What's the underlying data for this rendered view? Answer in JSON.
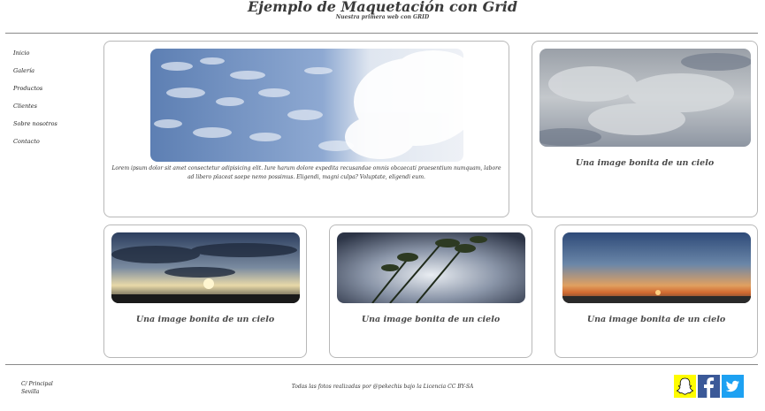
{
  "header": {
    "title": "Ejemplo de Maquetación con Grid",
    "subtitle": "Nuestra primera web con GRID"
  },
  "nav": {
    "items": [
      "Inicio",
      "Galería",
      "Productos",
      "Clientes",
      "Sobre nosotros",
      "Contacto"
    ]
  },
  "main_card": {
    "text": "Lorem ipsum dolor sit amet consectetur adipisicing elit. Iure harum dolore expedita recusandae omnis obcaecati praesentium numquam, labore ad libero placeat saepe nemo possimus. Eligendi, magni culpa? Voluptate, eligendi eum."
  },
  "cards": [
    {
      "caption": "Una image bonita de un cielo"
    },
    {
      "caption": "Una image bonita de un cielo"
    },
    {
      "caption": "Una image bonita de un cielo"
    },
    {
      "caption": "Una image bonita de un cielo"
    }
  ],
  "footer": {
    "address_line1": "C/ Principal",
    "address_line2": "Sevilla",
    "credit": "Todas las fotos realizadas por @pekechis bajo la Licencia CC BY-SA"
  },
  "social": {
    "icons": [
      "snapchat-icon",
      "facebook-icon",
      "twitter-icon"
    ],
    "colors": {
      "snapchat": "#FFFC00",
      "facebook": "#3b5998",
      "twitter": "#1DA1F2"
    }
  }
}
